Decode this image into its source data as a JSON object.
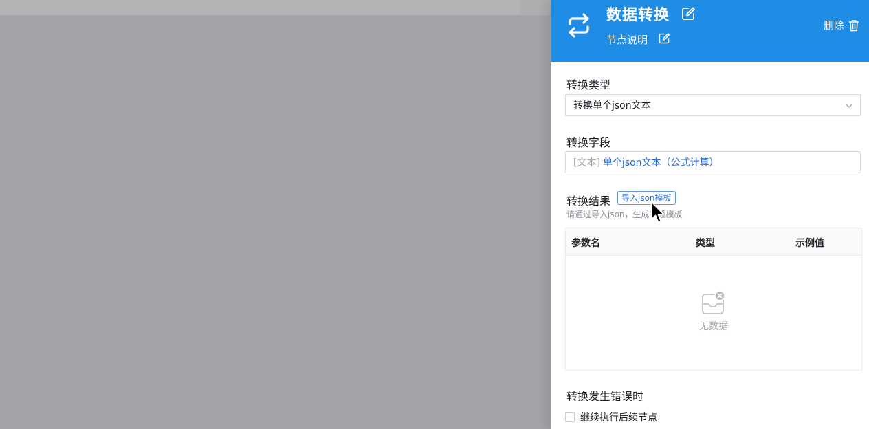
{
  "header": {
    "title": "数据转换",
    "description": "节点说明",
    "delete_label": "删除",
    "background_color": "#1f8ce6"
  },
  "icons": {
    "node": "swap-arrows-icon",
    "edit": "edit-icon",
    "delete": "trash-icon",
    "dropdown": "chevron-down-icon",
    "empty": "empty-inbox-icon"
  },
  "convert_type": {
    "label": "转换类型",
    "selected": "转换单个json文本"
  },
  "convert_field": {
    "label": "转换字段",
    "type_tag": "[文本]",
    "value": "单个json文本（公式计算）"
  },
  "convert_result": {
    "label": "转换结果",
    "import_button": "导入json模板",
    "hint": "请通过导入json，生成字段模板",
    "columns": [
      "参数名",
      "类型",
      "示例值"
    ],
    "rows": [],
    "empty_text": "无数据"
  },
  "on_error": {
    "label": "转换发生错误时",
    "checkbox_label": "继续执行后续节点",
    "checked": false
  }
}
